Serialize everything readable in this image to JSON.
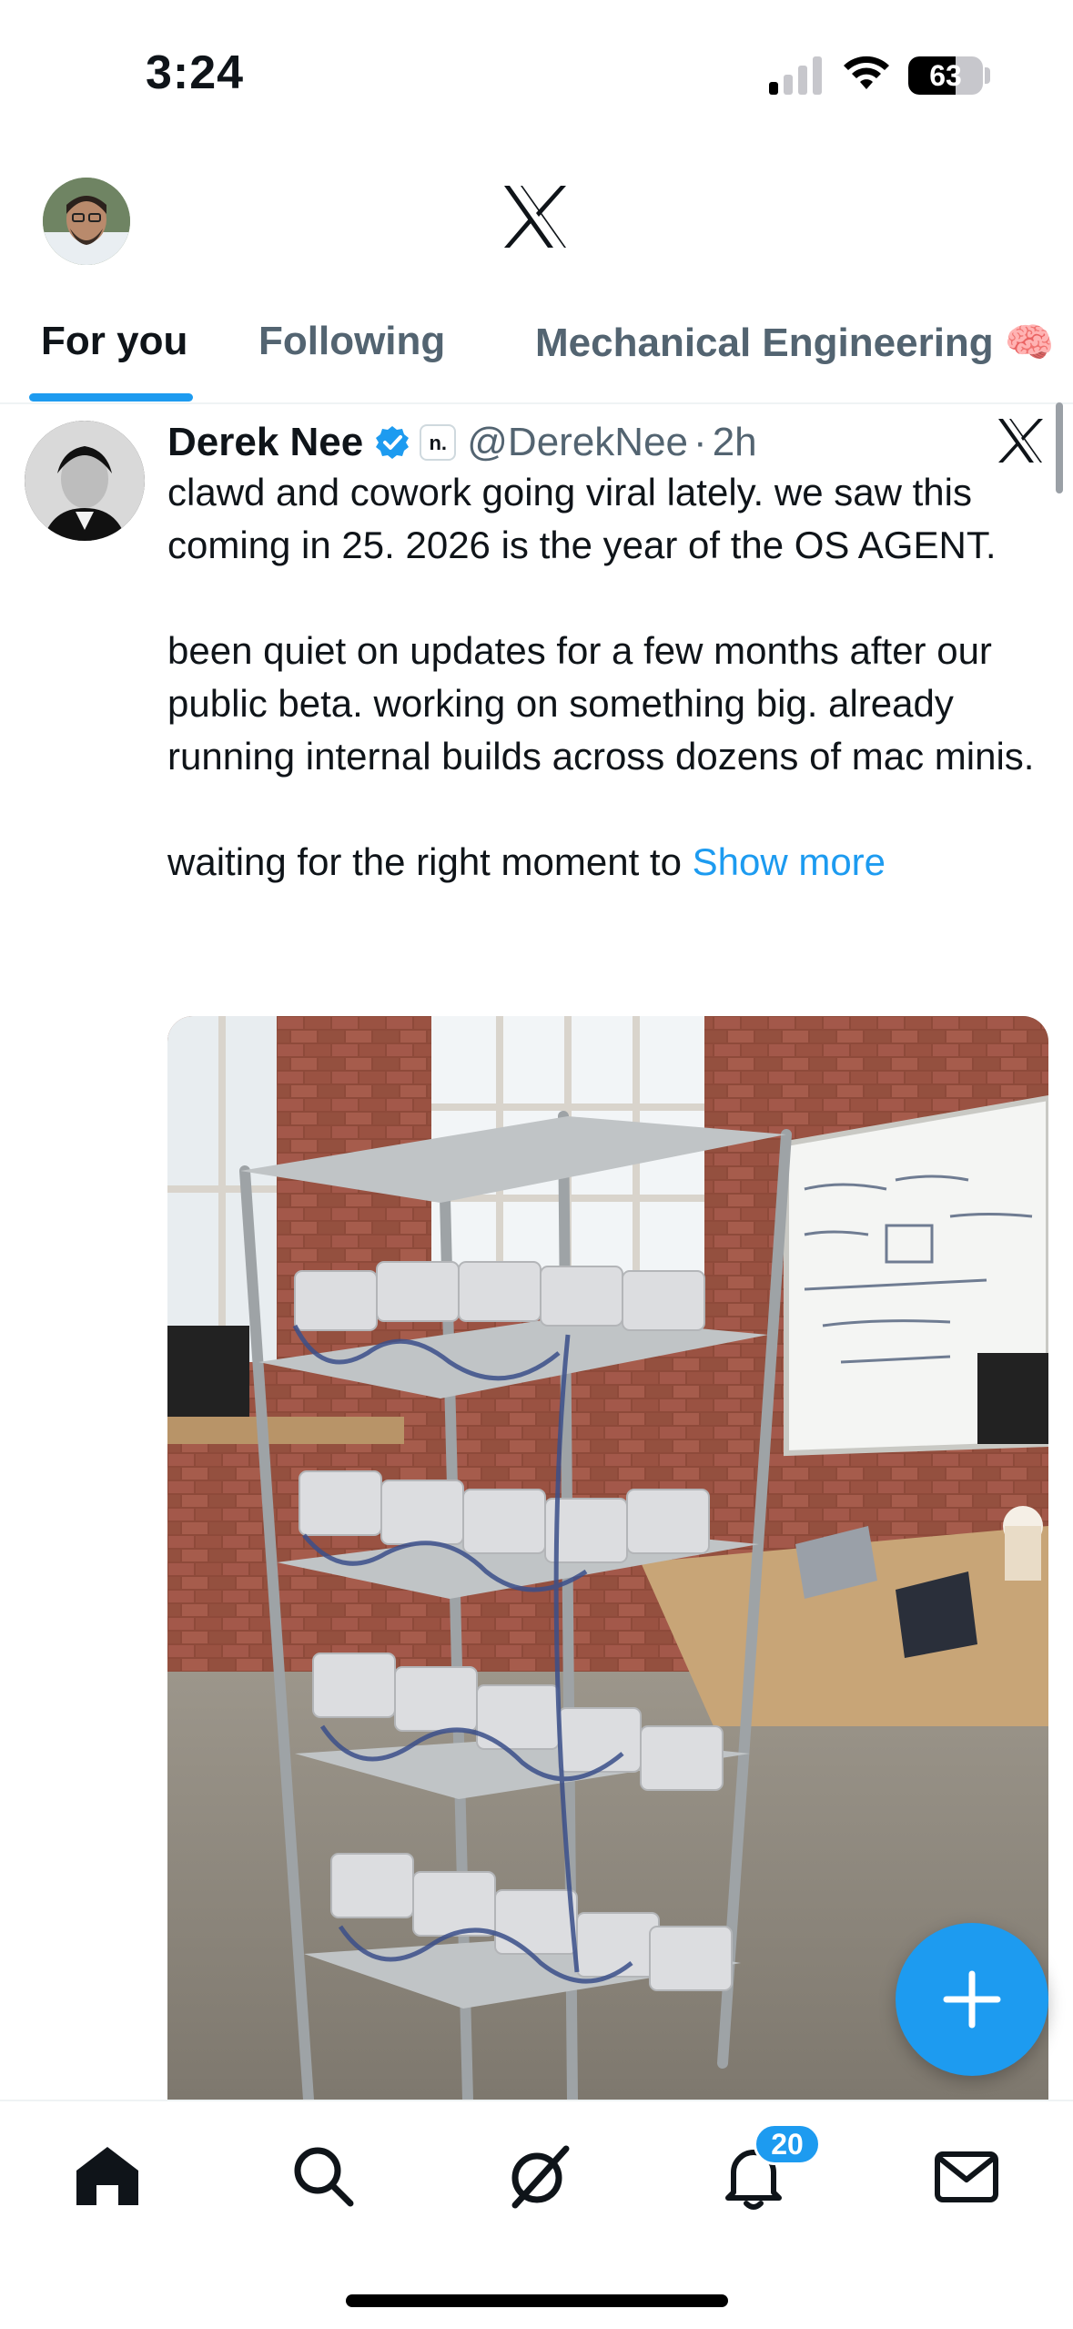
{
  "status_bar": {
    "time": "3:24",
    "battery_percent": "63",
    "battery_level": 0.63
  },
  "header": {
    "avatar_icon": "user-avatar",
    "logo_icon": "x-logo-icon"
  },
  "tabs": [
    {
      "label": "For you",
      "active": true
    },
    {
      "label": "Following",
      "active": false
    },
    {
      "label": "Mechanical Engineering 🧠",
      "active": false
    }
  ],
  "tweet": {
    "display_name": "Derek Nee",
    "affiliate_badge": "n.",
    "handle": "@DerekNee",
    "separator": "·",
    "time": "2h",
    "text": "clawd and cowork going viral lately. we saw this coming in 25. 2026 is the year of the OS AGENT.\n\nbeen quiet on updates for a few months after our public beta. working on something big. already running internal builds across dozens of mac minis.\n\nwaiting for the right moment to ",
    "show_more": "Show more",
    "media_icon": "photo-mac-mini-rack"
  },
  "bottom_nav": {
    "items": [
      "home-icon",
      "search-icon",
      "grok-icon",
      "notifications-icon",
      "messages-icon"
    ],
    "notifications_badge": "20"
  },
  "colors": {
    "accent": "#1d9bf0",
    "text": "#0f1419",
    "secondary": "#536471"
  }
}
